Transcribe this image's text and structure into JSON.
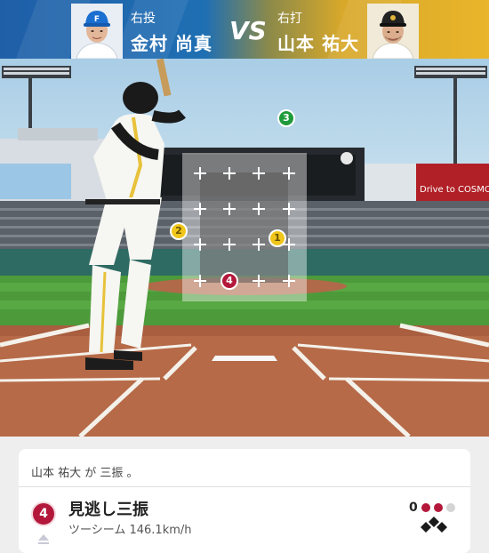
{
  "header": {
    "pitcher_role": "右投",
    "pitcher_name": "金村 尚真",
    "vs": "VS",
    "batter_role": "右打",
    "batter_name": "山本 祐大"
  },
  "scene": {
    "background_text": "Drive to COSMO",
    "pitches": [
      {
        "number": "1",
        "color": "yellow"
      },
      {
        "number": "2",
        "color": "yellow"
      },
      {
        "number": "3",
        "color": "green"
      },
      {
        "number": "4",
        "color": "red"
      }
    ]
  },
  "result_card": {
    "summary": "山本 祐大 が 三振 。",
    "pitch_number": "4",
    "result_title": "見逃し三振",
    "pitch_detail": "ツーシーム 146.1km/h",
    "outs": "0",
    "count_dots": [
      "red",
      "red",
      "gray"
    ]
  },
  "colors": {
    "header_blue": "#1f6fb3",
    "header_gold": "#e9b52a",
    "strike_red": "#b3183a",
    "ball_yellow": "#f0c61c",
    "foul_green": "#1f9a3b"
  }
}
